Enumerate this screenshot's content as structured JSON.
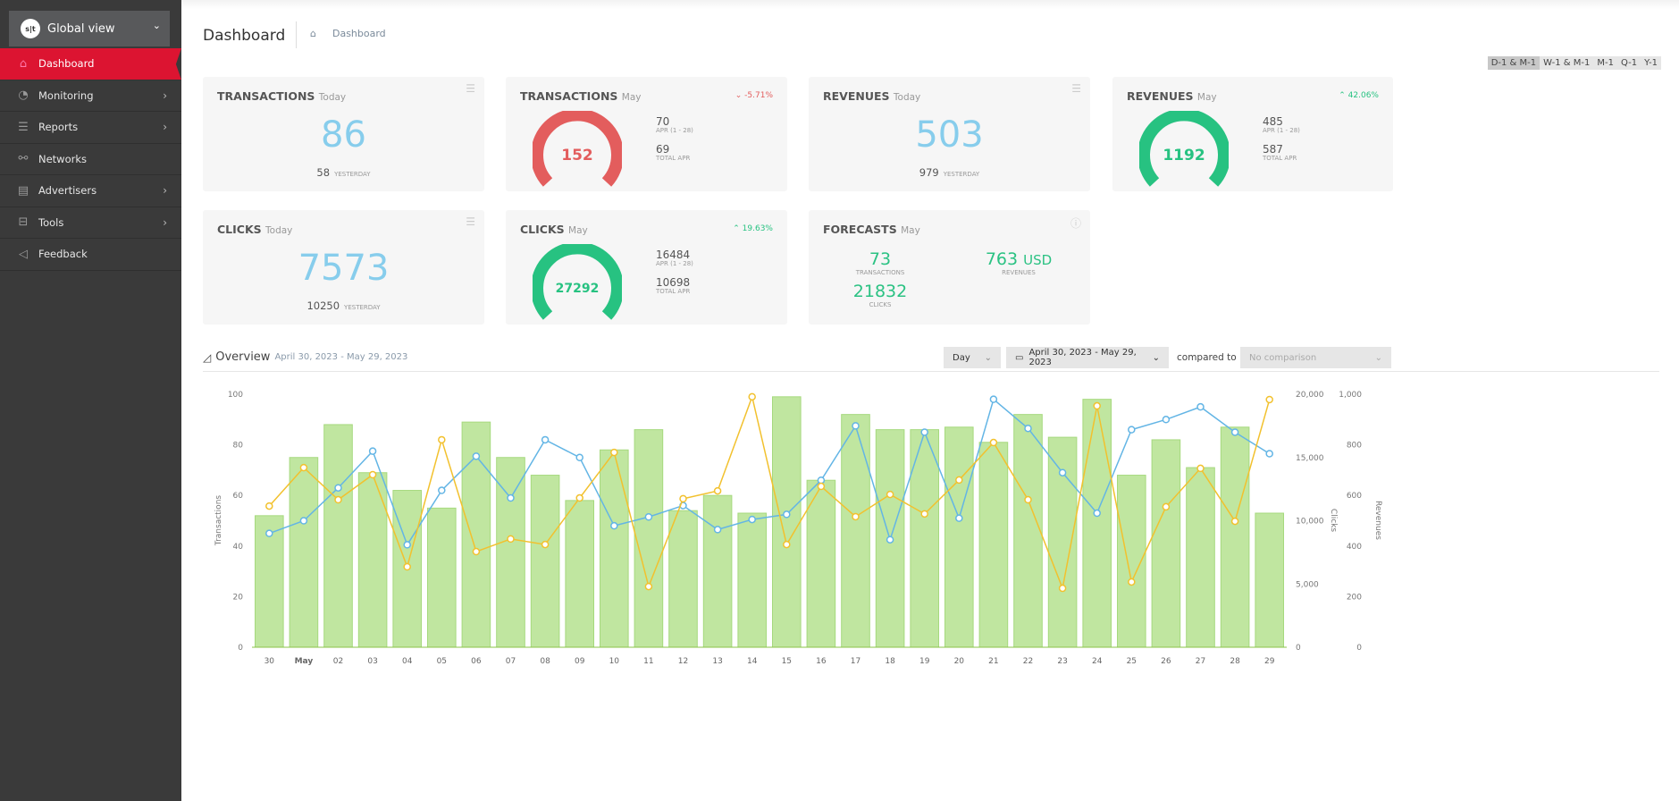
{
  "sidebar": {
    "selector": {
      "logo": "s|t",
      "label": "Global view"
    },
    "items": [
      {
        "label": "Dashboard",
        "icon": "home-icon",
        "glyph": "⌂"
      },
      {
        "label": "Monitoring",
        "icon": "gauge-icon",
        "glyph": "◔"
      },
      {
        "label": "Reports",
        "icon": "list-icon",
        "glyph": "☰"
      },
      {
        "label": "Networks",
        "icon": "network-icon",
        "glyph": "⚯"
      },
      {
        "label": "Advertisers",
        "icon": "store-icon",
        "glyph": "▤"
      },
      {
        "label": "Tools",
        "icon": "toolbox-icon",
        "glyph": "⊟"
      },
      {
        "label": "Feedback",
        "icon": "megaphone-icon",
        "glyph": "◁"
      }
    ]
  },
  "header": {
    "title": "Dashboard",
    "breadcrumb": "Dashboard"
  },
  "periods": [
    "D-1 & M-1",
    "W-1 & M-1",
    "M-1",
    "Q-1",
    "Y-1"
  ],
  "cards": {
    "tx_today": {
      "title": "TRANSACTIONS",
      "period": "Today",
      "value": "86",
      "prev": "58",
      "prev_label": "YESTERDAY"
    },
    "tx_may": {
      "title": "TRANSACTIONS",
      "period": "May",
      "change": "-5.71%",
      "value": "152",
      "s1": "70",
      "s1_label": "APR (1 - 28)",
      "s2": "69",
      "s2_label": "TOTAL APR"
    },
    "rev_today": {
      "title": "REVENUES",
      "period": "Today",
      "value": "503",
      "prev": "979",
      "prev_label": "YESTERDAY"
    },
    "rev_may": {
      "title": "REVENUES",
      "period": "May",
      "change": "42.06%",
      "value": "1192",
      "s1": "485",
      "s1_label": "APR (1 - 28)",
      "s2": "587",
      "s2_label": "TOTAL APR"
    },
    "clicks_today": {
      "title": "CLICKS",
      "period": "Today",
      "value": "7573",
      "prev": "10250",
      "prev_label": "YESTERDAY"
    },
    "clicks_may": {
      "title": "CLICKS",
      "period": "May",
      "change": "19.63%",
      "value": "27292",
      "s1": "16484",
      "s1_label": "APR (1 - 28)",
      "s2": "10698",
      "s2_label": "TOTAL APR"
    },
    "forecasts": {
      "title": "FORECASTS",
      "period": "May",
      "tx": "73",
      "tx_label": "TRANSACTIONS",
      "rev": "763",
      "rev_unit": "USD",
      "rev_label": "REVENUES",
      "clicks": "21832",
      "clicks_label": "CLICKS"
    }
  },
  "colors": {
    "red": "#e35d5d",
    "green": "#27c281",
    "blue": "#87cdec",
    "bar": "#c0e6a0",
    "clicks_line": "#63b5e5",
    "rev_line": "#f2c12e"
  },
  "overview": {
    "title": "Overview",
    "range": "April 30, 2023 - May 29, 2023",
    "granularity": "Day",
    "date_range": "April 30, 2023 - May 29, 2023",
    "compared_to": "compared to",
    "comparison": "No comparison"
  },
  "chart_data": {
    "type": "bar+line",
    "categories": [
      "30",
      "May",
      "02",
      "03",
      "04",
      "05",
      "06",
      "07",
      "08",
      "09",
      "10",
      "11",
      "12",
      "13",
      "14",
      "15",
      "16",
      "17",
      "18",
      "19",
      "20",
      "21",
      "22",
      "23",
      "24",
      "25",
      "26",
      "27",
      "28",
      "29"
    ],
    "series": [
      {
        "name": "Transactions",
        "type": "bar",
        "axis": "left",
        "values": [
          52,
          75,
          88,
          69,
          62,
          55,
          89,
          75,
          68,
          58,
          78,
          86,
          54,
          60,
          53,
          99,
          66,
          92,
          86,
          86,
          87,
          81,
          92,
          83,
          98,
          68,
          82,
          71,
          87,
          53
        ]
      },
      {
        "name": "Clicks",
        "type": "line",
        "axis": "right1",
        "values": [
          9000,
          10000,
          12600,
          15500,
          8100,
          12400,
          15100,
          11800,
          16400,
          15000,
          9600,
          10300,
          11200,
          9300,
          10100,
          10500,
          13200,
          17500,
          8500,
          17000,
          10200,
          19600,
          17300,
          13800,
          10600,
          17200,
          18000,
          19000,
          17000,
          15300
        ]
      },
      {
        "name": "Revenues",
        "type": "line",
        "axis": "right2",
        "values": [
          558,
          710,
          583,
          682,
          318,
          820,
          378,
          428,
          406,
          590,
          770,
          240,
          587,
          618,
          990,
          406,
          636,
          516,
          604,
          527,
          661,
          809,
          583,
          233,
          954,
          258,
          555,
          707,
          498,
          979
        ]
      }
    ],
    "axes": {
      "left": {
        "label": "Transactions",
        "range": [
          0,
          100
        ],
        "ticks": [
          0,
          20,
          40,
          60,
          80,
          100
        ]
      },
      "right1": {
        "label": "Clicks",
        "range": [
          0,
          20000
        ],
        "ticks": [
          "0",
          "5,000",
          "10,000",
          "15,000",
          "20,000"
        ]
      },
      "right2": {
        "label": "Revenues",
        "range": [
          0,
          1000
        ],
        "ticks": [
          "0",
          "200",
          "400",
          "600",
          "800",
          "1,000"
        ]
      }
    },
    "grid": false,
    "legend": "none"
  }
}
